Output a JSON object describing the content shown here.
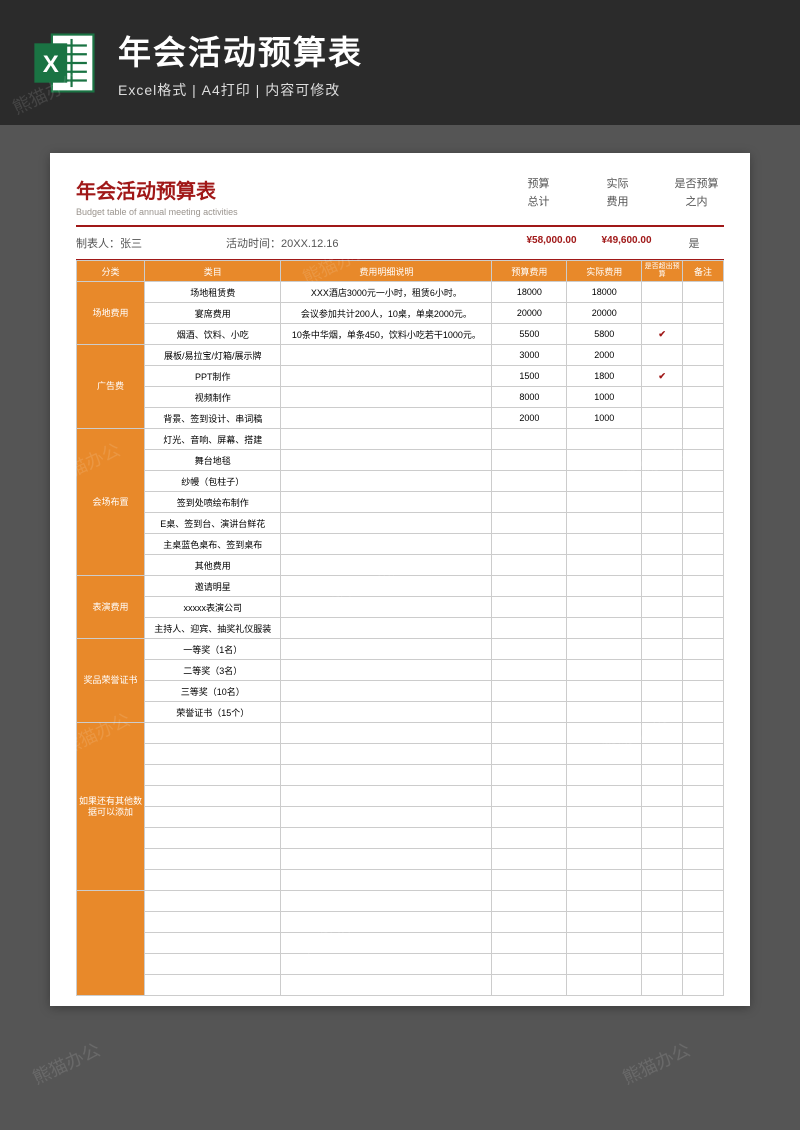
{
  "top": {
    "title": "年会活动预算表",
    "subtitle": "Excel格式 | A4打印 | 内容可修改"
  },
  "doc": {
    "title": "年会活动预算表",
    "subtitle": "Budget table of annual meeting activities"
  },
  "summary": {
    "budget_label1": "预算",
    "budget_label2": "总计",
    "actual_label1": "实际",
    "actual_label2": "费用",
    "within_label1": "是否预算",
    "within_label2": "之内"
  },
  "meta": {
    "maker": "制表人：张三",
    "time": "活动时间：20XX.12.16",
    "budget_total": "¥58,000.00",
    "actual_total": "¥49,600.00",
    "within": "是"
  },
  "headers": {
    "cat": "分类",
    "item": "类目",
    "desc": "费用明细说明",
    "budget": "预算费用",
    "actual": "实际费用",
    "over": "是否超出预算",
    "note": "备注"
  },
  "groups": [
    {
      "cat": "场地费用",
      "rows": [
        {
          "item": "场地租赁费",
          "desc": "XXX酒店3000元一小时，租赁6小时。",
          "budget": "18000",
          "actual": "18000",
          "over": "",
          "note": ""
        },
        {
          "item": "宴席费用",
          "desc": "会议参加共计200人，10桌，单桌2000元。",
          "budget": "20000",
          "actual": "20000",
          "over": "",
          "note": ""
        },
        {
          "item": "烟酒、饮料、小吃",
          "desc": "10条中华烟，单条450，饮料小吃若干1000元。",
          "budget": "5500",
          "actual": "5800",
          "over": "✔",
          "note": ""
        }
      ]
    },
    {
      "cat": "广告费",
      "rows": [
        {
          "item": "展板/易拉宝/灯箱/展示牌",
          "desc": "",
          "budget": "3000",
          "actual": "2000",
          "over": "",
          "note": ""
        },
        {
          "item": "PPT制作",
          "desc": "",
          "budget": "1500",
          "actual": "1800",
          "over": "✔",
          "note": ""
        },
        {
          "item": "视频制作",
          "desc": "",
          "budget": "8000",
          "actual": "1000",
          "over": "",
          "note": ""
        },
        {
          "item": "背景、签到设计、串词稿",
          "desc": "",
          "budget": "2000",
          "actual": "1000",
          "over": "",
          "note": ""
        }
      ]
    },
    {
      "cat": "会场布置",
      "rows": [
        {
          "item": "灯光、音响、屏幕、搭建",
          "desc": "",
          "budget": "",
          "actual": "",
          "over": "",
          "note": ""
        },
        {
          "item": "舞台地毯",
          "desc": "",
          "budget": "",
          "actual": "",
          "over": "",
          "note": ""
        },
        {
          "item": "纱幔（包柱子）",
          "desc": "",
          "budget": "",
          "actual": "",
          "over": "",
          "note": ""
        },
        {
          "item": "签到处喷绘布制作",
          "desc": "",
          "budget": "",
          "actual": "",
          "over": "",
          "note": ""
        },
        {
          "item": "E桌、签到台、演讲台鲜花",
          "desc": "",
          "budget": "",
          "actual": "",
          "over": "",
          "note": ""
        },
        {
          "item": "主桌蓝色桌布、签到桌布",
          "desc": "",
          "budget": "",
          "actual": "",
          "over": "",
          "note": ""
        },
        {
          "item": "其他费用",
          "desc": "",
          "budget": "",
          "actual": "",
          "over": "",
          "note": ""
        }
      ]
    },
    {
      "cat": "表演费用",
      "rows": [
        {
          "item": "邀请明星",
          "desc": "",
          "budget": "",
          "actual": "",
          "over": "",
          "note": ""
        },
        {
          "item": "xxxxx表演公司",
          "desc": "",
          "budget": "",
          "actual": "",
          "over": "",
          "note": ""
        },
        {
          "item": "主持人、迎宾、抽奖礼仪服装",
          "desc": "",
          "budget": "",
          "actual": "",
          "over": "",
          "note": ""
        }
      ]
    },
    {
      "cat": "奖品荣誉证书",
      "rows": [
        {
          "item": "一等奖（1名）",
          "desc": "",
          "budget": "",
          "actual": "",
          "over": "",
          "note": ""
        },
        {
          "item": "二等奖（3名）",
          "desc": "",
          "budget": "",
          "actual": "",
          "over": "",
          "note": ""
        },
        {
          "item": "三等奖（10名）",
          "desc": "",
          "budget": "",
          "actual": "",
          "over": "",
          "note": ""
        },
        {
          "item": "荣誉证书（15个）",
          "desc": "",
          "budget": "",
          "actual": "",
          "over": "",
          "note": ""
        }
      ]
    },
    {
      "cat": "如果还有其他数据可以添加",
      "rows": [
        {
          "item": "",
          "desc": "",
          "budget": "",
          "actual": "",
          "over": "",
          "note": ""
        },
        {
          "item": "",
          "desc": "",
          "budget": "",
          "actual": "",
          "over": "",
          "note": ""
        },
        {
          "item": "",
          "desc": "",
          "budget": "",
          "actual": "",
          "over": "",
          "note": ""
        },
        {
          "item": "",
          "desc": "",
          "budget": "",
          "actual": "",
          "over": "",
          "note": ""
        },
        {
          "item": "",
          "desc": "",
          "budget": "",
          "actual": "",
          "over": "",
          "note": ""
        },
        {
          "item": "",
          "desc": "",
          "budget": "",
          "actual": "",
          "over": "",
          "note": ""
        },
        {
          "item": "",
          "desc": "",
          "budget": "",
          "actual": "",
          "over": "",
          "note": ""
        },
        {
          "item": "",
          "desc": "",
          "budget": "",
          "actual": "",
          "over": "",
          "note": ""
        }
      ]
    },
    {
      "cat": "",
      "rows": [
        {
          "item": "",
          "desc": "",
          "budget": "",
          "actual": "",
          "over": "",
          "note": ""
        },
        {
          "item": "",
          "desc": "",
          "budget": "",
          "actual": "",
          "over": "",
          "note": ""
        },
        {
          "item": "",
          "desc": "",
          "budget": "",
          "actual": "",
          "over": "",
          "note": ""
        },
        {
          "item": "",
          "desc": "",
          "budget": "",
          "actual": "",
          "over": "",
          "note": ""
        },
        {
          "item": "",
          "desc": "",
          "budget": "",
          "actual": "",
          "over": "",
          "note": ""
        }
      ]
    }
  ],
  "watermark": "熊猫办公",
  "watermark_url": "WWW.TUKUPPT.COM"
}
